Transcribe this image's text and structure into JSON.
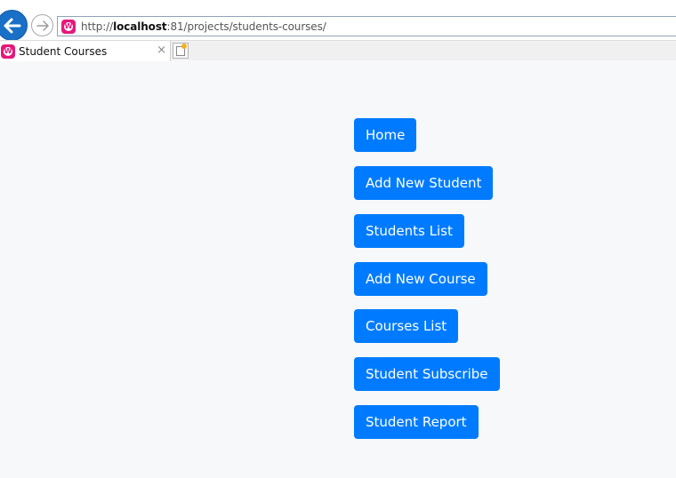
{
  "browser": {
    "url_prefix": "http://",
    "url_host": "localhost",
    "url_rest": ":81/projects/students-courses/",
    "tab_title": "Student Courses",
    "tab_close": "×",
    "favicon_letter": "W"
  },
  "colors": {
    "button_bg": "#007bff",
    "page_bg": "#f7f8fa"
  },
  "nav": {
    "buttons": [
      "Home",
      "Add New Student",
      "Students List",
      "Add New Course",
      "Courses List",
      "Student Subscribe",
      "Student Report"
    ]
  },
  "icons": [
    "back-arrow-icon",
    "forward-arrow-icon",
    "site-favicon-icon",
    "close-icon",
    "new-tab-icon"
  ]
}
